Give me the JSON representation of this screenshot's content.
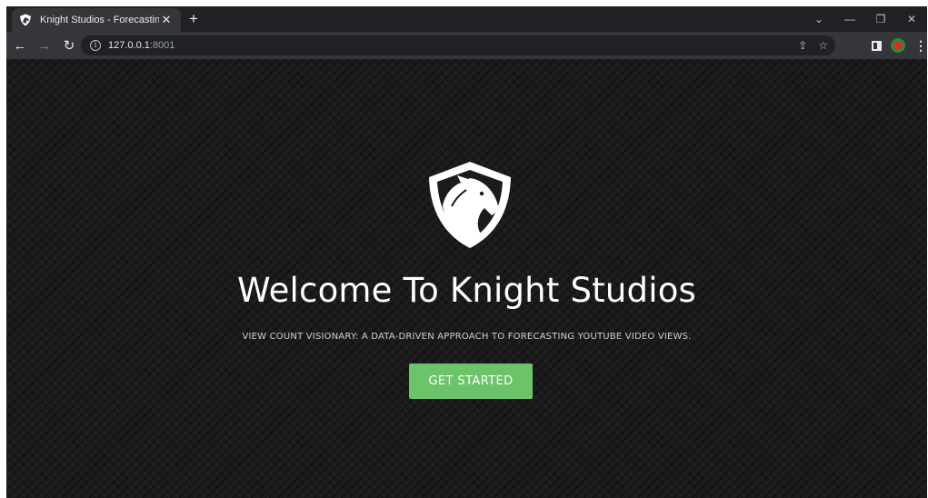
{
  "browser": {
    "tab_title": "Knight Studios - Forecasting",
    "tab_close": "✕",
    "new_tab": "+",
    "url_host": "127.0.0.1",
    "url_port": ":8001",
    "window_controls": {
      "chevron": "⌄",
      "minimize": "—",
      "restore": "❐",
      "close": "✕"
    },
    "nav": {
      "back": "←",
      "forward": "→",
      "reload": "↻"
    },
    "info_glyph": "i",
    "share_glyph": "⇪",
    "bookmark_glyph": "☆",
    "menu_glyph": "⋮"
  },
  "page": {
    "headline": "Welcome To Knight Studios",
    "tagline": "VIEW COUNT VISIONARY: A DATA-DRIVEN APPROACH TO FORECASTING YOUTUBE VIDEO VIEWS.",
    "cta_label": "GET STARTED"
  },
  "colors": {
    "background": "#1b1b1b",
    "cta": "#6cc36a",
    "text": "#ffffff"
  },
  "icons": [
    "knight-shield-icon",
    "back-icon",
    "forward-icon",
    "reload-icon",
    "info-icon",
    "share-icon",
    "bookmark-icon",
    "side-panel-icon",
    "profile-icon",
    "menu-icon"
  ]
}
